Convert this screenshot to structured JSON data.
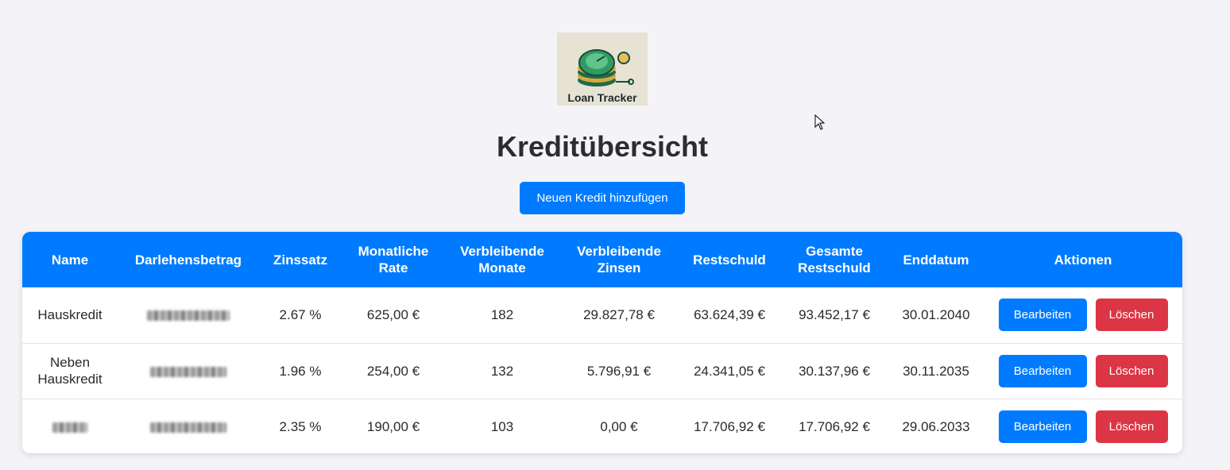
{
  "logo": {
    "text": "Loan Tracker",
    "icon": "coin-stack-gauge-icon"
  },
  "page_title": "Kreditübersicht",
  "add_button": "Neuen Kredit hinzufügen",
  "table": {
    "headers": [
      "Name",
      "Darlehensbetrag",
      "Zinssatz",
      "Monatliche Rate",
      "Verbleibende Monate",
      "Verbleibende Zinsen",
      "Restschuld",
      "Gesamte Restschuld",
      "Enddatum",
      "Aktionen"
    ],
    "rows": [
      {
        "name": "Hauskredit",
        "amount": "",
        "rate": "2.67 %",
        "monthly": "625,00 €",
        "months_left": "182",
        "interest_left": "29.827,78 €",
        "debt": "63.624,39 €",
        "total_debt": "93.452,17 €",
        "end_date": "30.01.2040"
      },
      {
        "name": "Neben Hauskredit",
        "amount": "",
        "rate": "1.96 %",
        "monthly": "254,00 €",
        "months_left": "132",
        "interest_left": "5.796,91 €",
        "debt": "24.341,05 €",
        "total_debt": "30.137,96 €",
        "end_date": "30.11.2035"
      },
      {
        "name": "",
        "amount": "",
        "rate": "2.35 %",
        "monthly": "190,00 €",
        "months_left": "103",
        "interest_left": "0,00 €",
        "debt": "17.706,92 €",
        "total_debt": "17.706,92 €",
        "end_date": "29.06.2033"
      }
    ],
    "edit_label": "Bearbeiten",
    "delete_label": "Löschen"
  },
  "colors": {
    "primary": "#007bff",
    "danger": "#dc3545",
    "background": "#f4f4f8"
  }
}
